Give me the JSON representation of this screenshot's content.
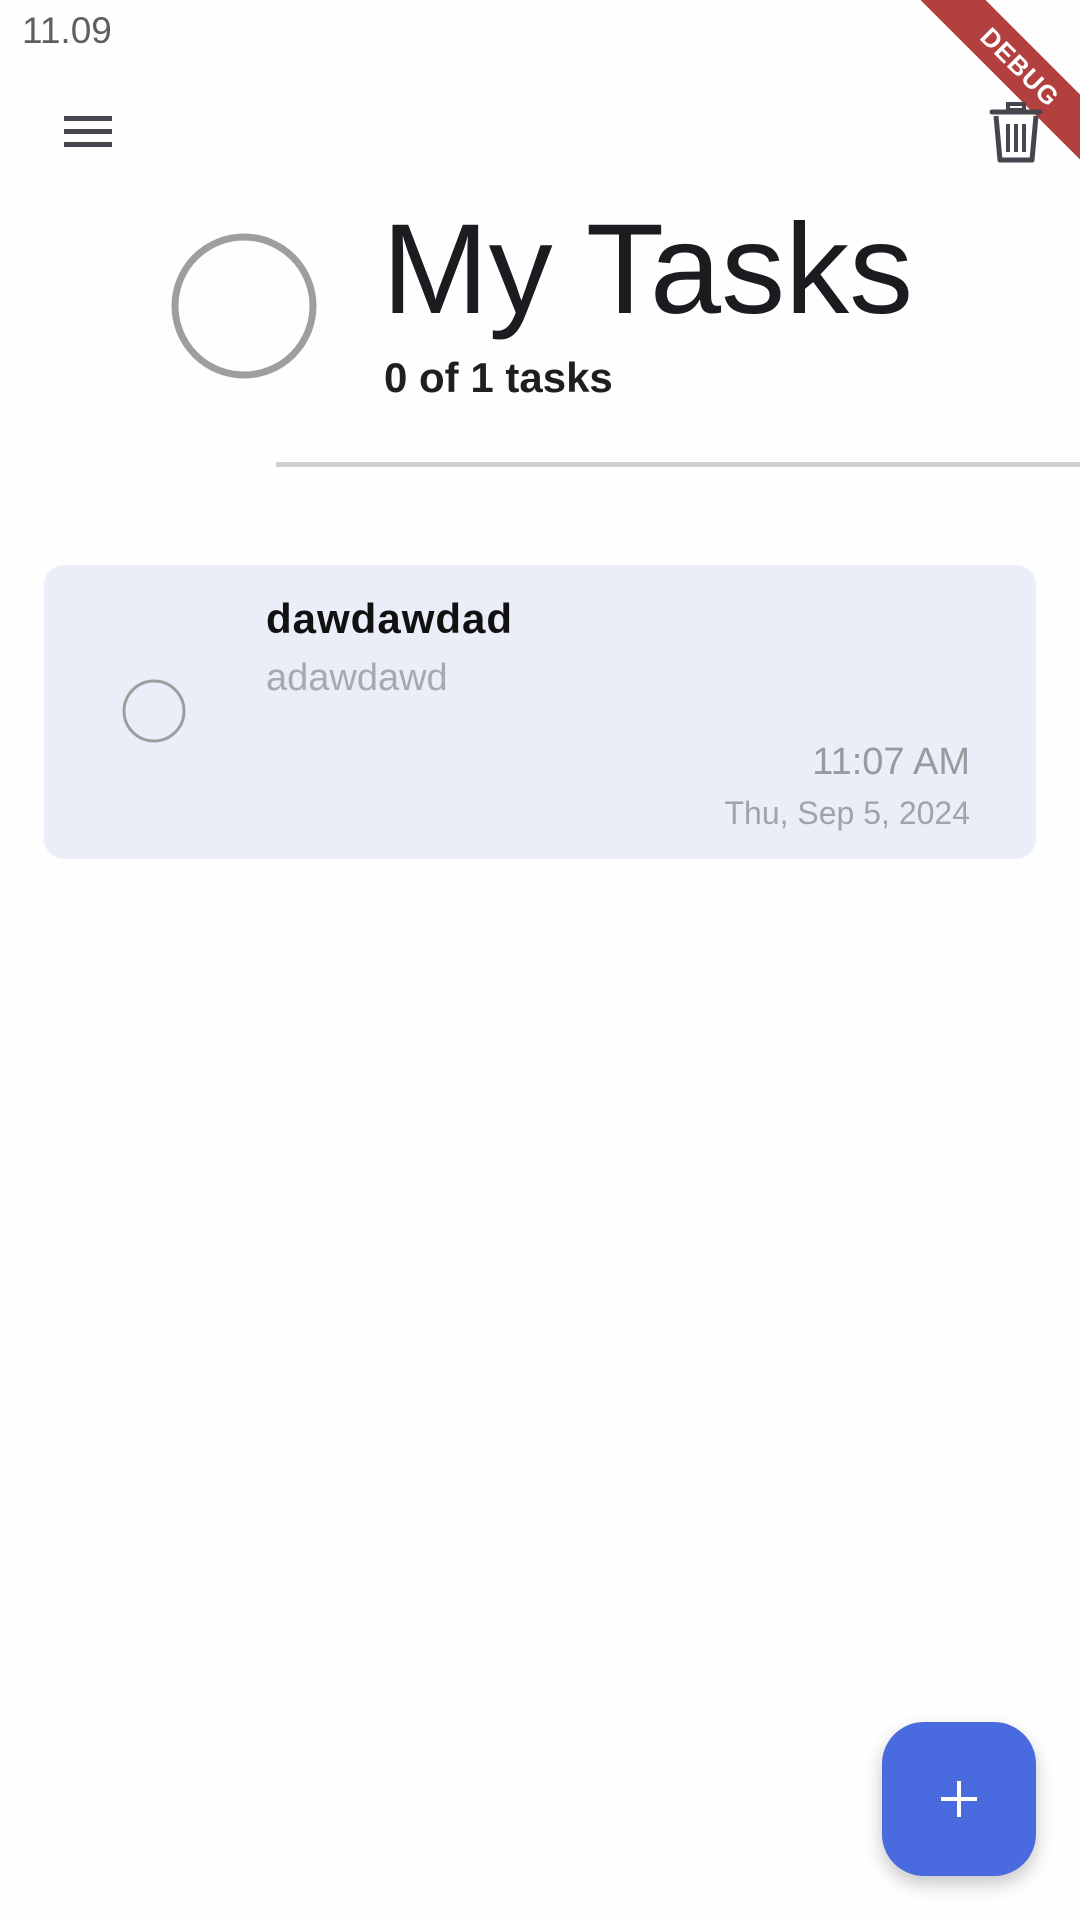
{
  "status_bar": {
    "time": "11.09"
  },
  "debug_banner": {
    "label": "DEBUG"
  },
  "header": {
    "title": "My Tasks",
    "task_count": "0 of 1 tasks",
    "progress": 0
  },
  "tasks": [
    {
      "title": "dawdawdad",
      "description": "adawdawd",
      "time": "11:07 AM",
      "date": "Thu, Sep 5, 2024",
      "completed": false
    }
  ],
  "colors": {
    "accent": "#4a6ae0",
    "card_background": "#eaeef9",
    "ring": "#9e9e9e",
    "debug_ribbon": "#b2403f"
  },
  "icons": {
    "menu": "menu-icon",
    "delete": "trash-icon",
    "add": "plus-icon"
  }
}
